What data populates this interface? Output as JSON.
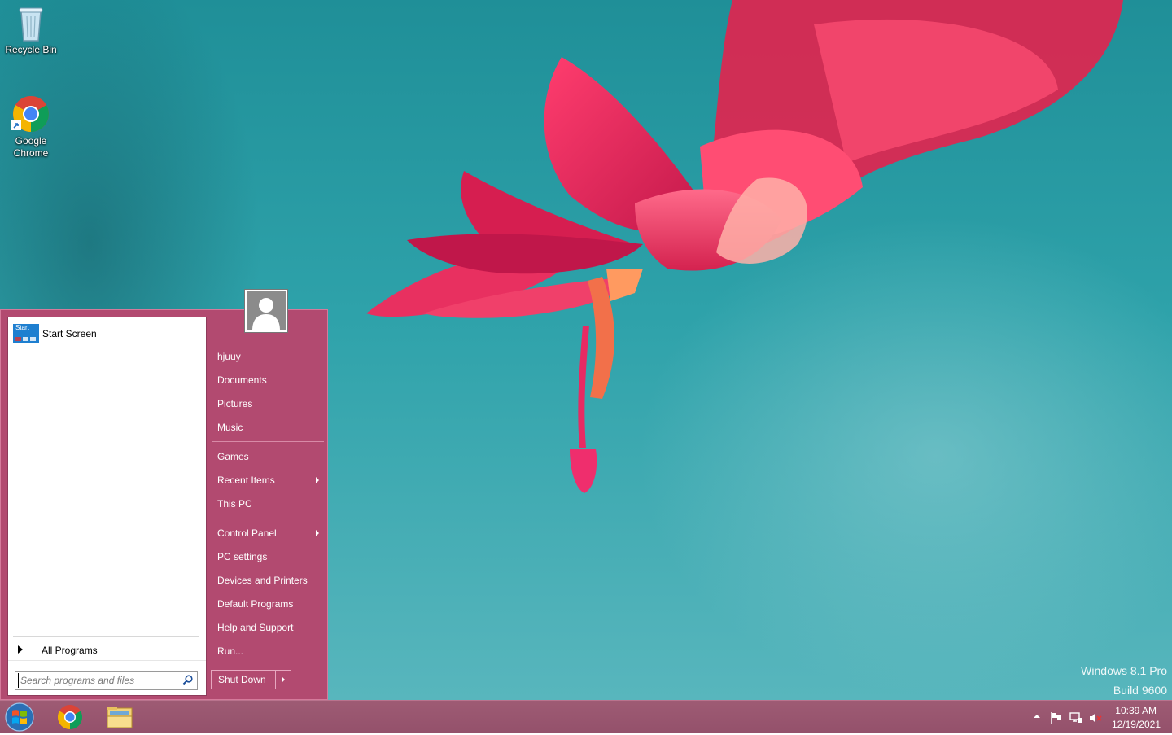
{
  "desktop": {
    "icons": [
      {
        "label": "Recycle Bin",
        "icon": "recycle-bin-icon"
      },
      {
        "label": "Google\nChrome",
        "label_line1": "Google",
        "label_line2": "Chrome",
        "icon": "chrome-icon"
      }
    ],
    "watermark": {
      "line1": "Windows 8.1 Pro",
      "line2": "Build 9600"
    }
  },
  "start_menu": {
    "pinned": [
      {
        "label": "Start Screen",
        "tile_text": "Start",
        "icon": "start-screen-tile-icon"
      }
    ],
    "all_programs_label": "All Programs",
    "search": {
      "placeholder": "Search programs and files",
      "value": ""
    },
    "user_picture": "user-avatar-icon",
    "right_items": [
      {
        "label": "hjuuy",
        "submenu": false
      },
      {
        "label": "Documents",
        "submenu": false
      },
      {
        "label": "Pictures",
        "submenu": false
      },
      {
        "label": "Music",
        "submenu": false
      },
      {
        "label": "Games",
        "submenu": false
      },
      {
        "label": "Recent Items",
        "submenu": true
      },
      {
        "label": "This PC",
        "submenu": false
      },
      {
        "label": "Control Panel",
        "submenu": true
      },
      {
        "label": "PC settings",
        "submenu": false
      },
      {
        "label": "Devices and Printers",
        "submenu": false
      },
      {
        "label": "Default Programs",
        "submenu": false
      },
      {
        "label": "Help and Support",
        "submenu": false
      },
      {
        "label": "Run...",
        "submenu": false
      }
    ],
    "shutdown_label": "Shut Down",
    "accent_color": "#b24a70"
  },
  "taskbar": {
    "buttons": [
      "start-orb-icon",
      "chrome-icon",
      "file-explorer-icon"
    ],
    "tray_icons": [
      "show-hidden-icons-chevron-icon",
      "action-center-flag-icon",
      "network-icon",
      "volume-muted-icon"
    ],
    "clock": {
      "time": "10:39 AM",
      "date": "12/19/2021"
    },
    "color": "#9e5b74"
  }
}
